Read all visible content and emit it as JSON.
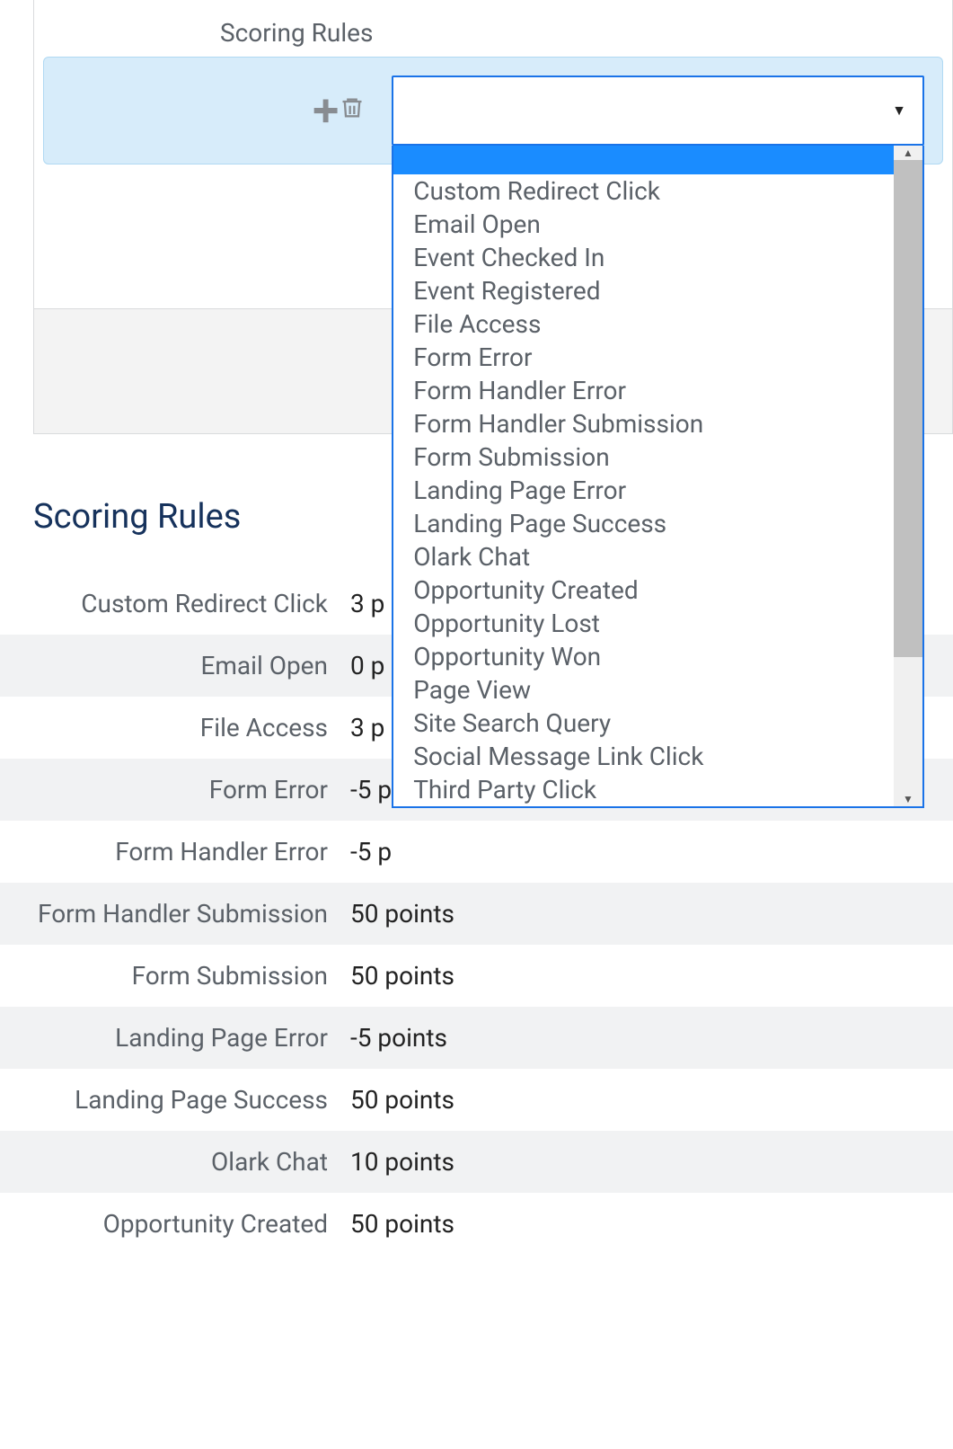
{
  "panel": {
    "header_label": "Scoring Rules"
  },
  "dropdown": {
    "selected": "",
    "options": [
      "Custom Redirect Click",
      "Email Open",
      "Event Checked In",
      "Event Registered",
      "File Access",
      "Form Error",
      "Form Handler Error",
      "Form Handler Submission",
      "Form Submission",
      "Landing Page Error",
      "Landing Page Success",
      "Olark Chat",
      "Opportunity Created",
      "Opportunity Lost",
      "Opportunity Won",
      "Page View",
      "Site Search Query",
      "Social Message Link Click",
      "Third Party Click"
    ]
  },
  "section": {
    "title": "Scoring Rules"
  },
  "rules": [
    {
      "label": "Custom Redirect Click",
      "value": "3 p"
    },
    {
      "label": "Email Open",
      "value": "0 p"
    },
    {
      "label": "File Access",
      "value": "3 p"
    },
    {
      "label": "Form Error",
      "value": "-5 p"
    },
    {
      "label": "Form Handler Error",
      "value": "-5 p"
    },
    {
      "label": "Form Handler Submission",
      "value": "50 points"
    },
    {
      "label": "Form Submission",
      "value": "50 points"
    },
    {
      "label": "Landing Page Error",
      "value": "-5 points"
    },
    {
      "label": "Landing Page Success",
      "value": "50 points"
    },
    {
      "label": "Olark Chat",
      "value": "10 points"
    },
    {
      "label": "Opportunity Created",
      "value": "50 points"
    }
  ]
}
